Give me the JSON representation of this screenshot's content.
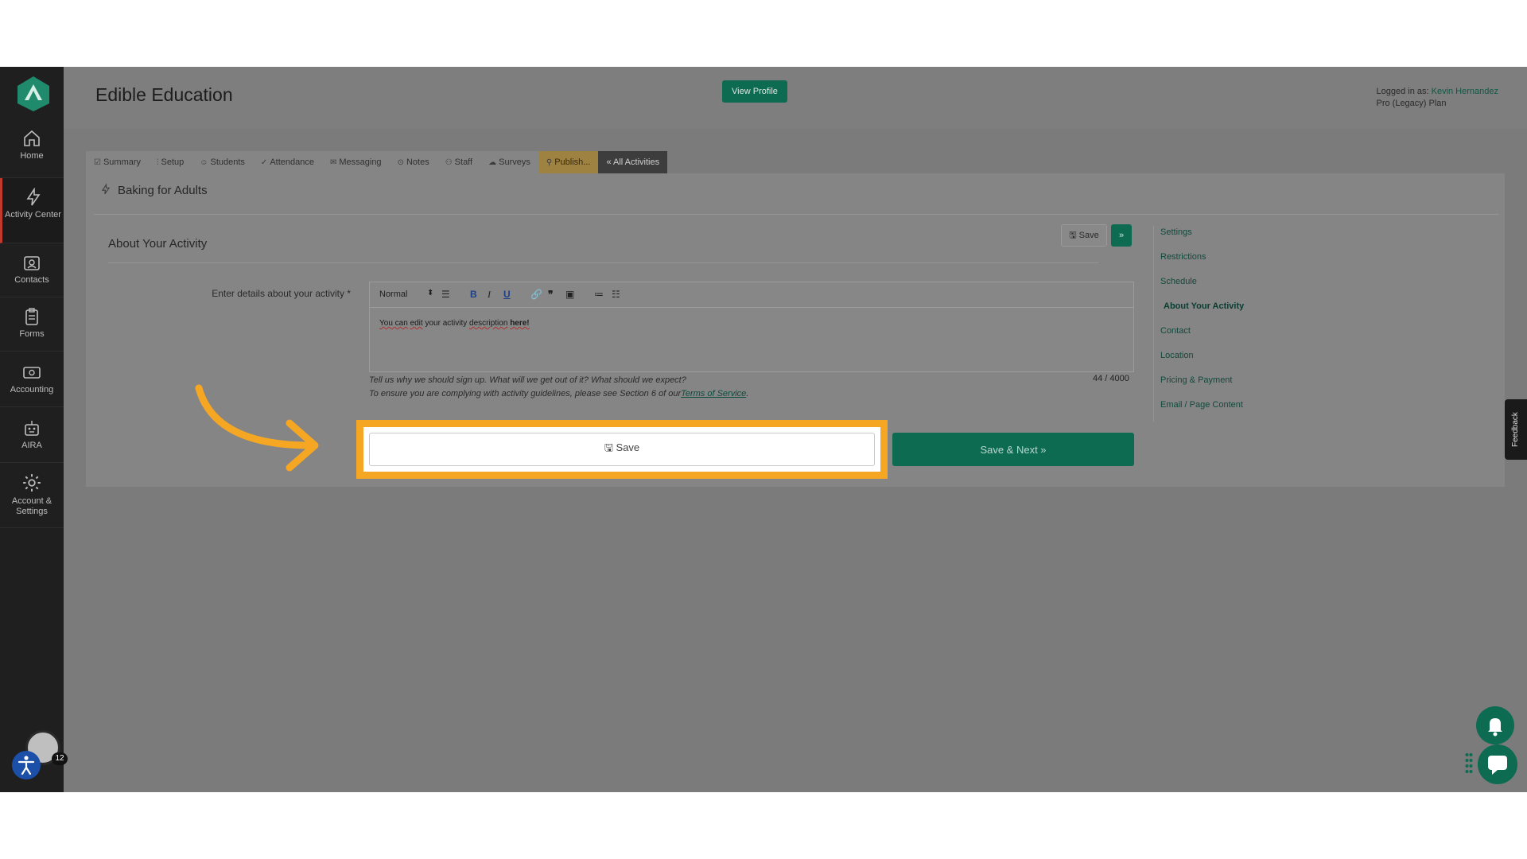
{
  "app": {
    "org_name": "Edible Education",
    "view_profile": "View Profile",
    "login_prefix": "Logged in as:",
    "login_user": "Kevin Hernandez",
    "plan": "Pro (Legacy) Plan"
  },
  "sidebar": {
    "items": [
      {
        "label": "Home",
        "icon": "home-icon"
      },
      {
        "label": "Activity Center",
        "icon": "lightning-icon"
      },
      {
        "label": "Contacts",
        "icon": "contacts-icon"
      },
      {
        "label": "Forms",
        "icon": "clipboard-icon"
      },
      {
        "label": "Accounting",
        "icon": "cash-icon"
      },
      {
        "label": "AIRA",
        "icon": "robot-icon"
      },
      {
        "label": "Account & Settings",
        "icon": "gear-icon"
      }
    ],
    "notification_count": "12"
  },
  "tabs": [
    {
      "label": "Summary",
      "icon": "☑"
    },
    {
      "label": "Setup",
      "icon": "⫶"
    },
    {
      "label": "Students",
      "icon": "☺"
    },
    {
      "label": "Attendance",
      "icon": "✓"
    },
    {
      "label": "Messaging",
      "icon": "✉"
    },
    {
      "label": "Notes",
      "icon": "⊙"
    },
    {
      "label": "Staff",
      "icon": "⚇"
    },
    {
      "label": "Surveys",
      "icon": "☁"
    },
    {
      "label": "Publish...",
      "icon": "⚲"
    },
    {
      "label": "« All Activities",
      "icon": ""
    }
  ],
  "activity": {
    "name": "Baking for Adults",
    "section_title": "About Your Activity",
    "top_save_label": "Save",
    "top_next_label": "»",
    "field_label": "Enter details about your activity *",
    "editor": {
      "format": "Normal",
      "content_prefix": "You can",
      "content_edit": "edit",
      "content_mid": "your activity",
      "content_desc": "description",
      "content_here": "here!"
    },
    "char_count": "44 / 4000",
    "help_line1": "Tell us why we should sign up. What will we get out of it? What should we expect?",
    "help_line2_prefix": "To ensure you are complying with activity guidelines, please see Section 6 of our",
    "help_line2_link": "Terms of Service",
    "help_line2_suffix": ".",
    "save_label": "Save",
    "save_next_label": "Save & Next »"
  },
  "right_nav": [
    {
      "label": "Settings"
    },
    {
      "label": "Restrictions"
    },
    {
      "label": "Schedule"
    },
    {
      "label": "About Your Activity",
      "active": true
    },
    {
      "label": "Contact"
    },
    {
      "label": "Location"
    },
    {
      "label": "Pricing & Payment"
    },
    {
      "label": "Email / Page Content"
    }
  ],
  "feedback_label": "Feedback",
  "colors": {
    "brand_green": "#0d6b52",
    "highlight_orange": "#f5a623"
  }
}
